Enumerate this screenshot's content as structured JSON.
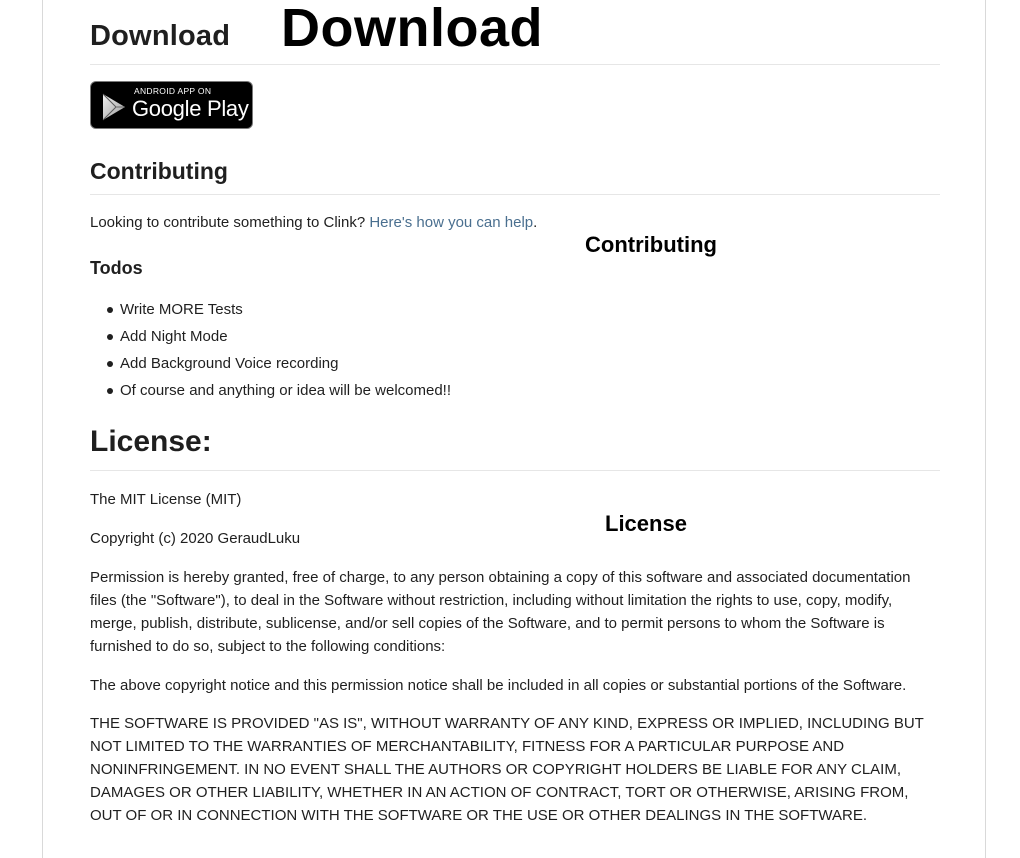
{
  "sections": {
    "download": {
      "heading": "Download",
      "badge": {
        "small_text": "ANDROID APP ON",
        "big_text": "Google Play",
        "icon": "google-play-icon"
      }
    },
    "contributing": {
      "heading": "Contributing",
      "text_before_link": "Looking to contribute something to Clink? ",
      "link_text": "Here's how you can help",
      "text_after_link": ".",
      "link_color": "#4a6f8f"
    },
    "todos": {
      "heading": "Todos",
      "items": [
        "Write MORE Tests",
        "Add Night Mode",
        "Add Background Voice recording",
        "Of course and anything or idea will be welcomed!!"
      ]
    },
    "license": {
      "heading": "License:",
      "name": "The MIT License (MIT)",
      "copyright": "Copyright (c) 2020 GeraudLuku",
      "permission": "Permission is hereby granted, free of charge, to any person obtaining a copy of this software and associated documentation files (the \"Software\"), to deal in the Software without restriction, including without limitation the rights to use, copy, modify, merge, publish, distribute, sublicense, and/or sell copies of the Software, and to permit persons to whom the Software is furnished to do so, subject to the following conditions:",
      "notice": "The above copyright notice and this permission notice shall be included in all copies or substantial portions of the Software.",
      "warranty": "THE SOFTWARE IS PROVIDED \"AS IS\", WITHOUT WARRANTY OF ANY KIND, EXPRESS OR IMPLIED, INCLUDING BUT NOT LIMITED TO THE WARRANTIES OF MERCHANTABILITY, FITNESS FOR A PARTICULAR PURPOSE AND NONINFRINGEMENT. IN NO EVENT SHALL THE AUTHORS OR COPYRIGHT HOLDERS BE LIABLE FOR ANY CLAIM, DAMAGES OR OTHER LIABILITY, WHETHER IN AN ACTION OF CONTRACT, TORT OR OTHERWISE, ARISING FROM, OUT OF OR IN CONNECTION WITH THE SOFTWARE OR THE USE OR OTHER DEALINGS IN THE SOFTWARE."
    }
  },
  "annotations": {
    "download": "Download",
    "contributing": "Contributing",
    "license": "License"
  }
}
